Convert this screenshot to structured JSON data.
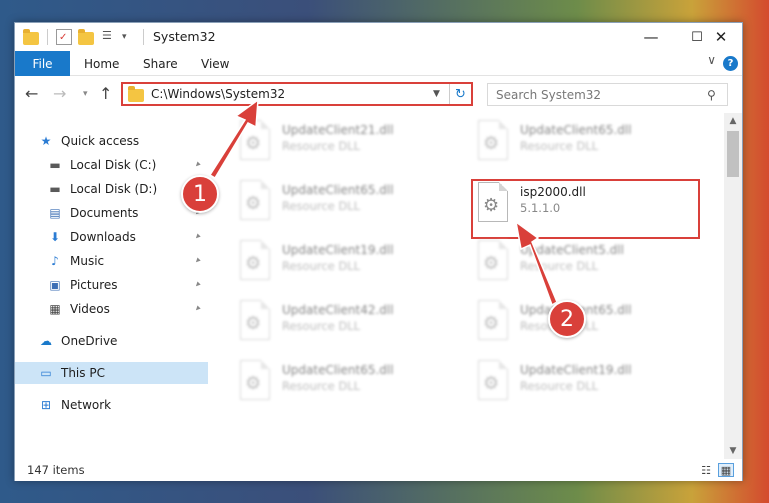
{
  "window": {
    "title": "System32",
    "controls": {
      "minimize": "—",
      "maximize": "☐",
      "close": "✕"
    }
  },
  "ribbon": {
    "tabs": [
      "File",
      "Home",
      "Share",
      "View"
    ],
    "help": "?"
  },
  "navbar": {
    "back": "←",
    "forward": "→",
    "up": "↑",
    "address": "C:\\Windows\\System32",
    "refresh": "↻",
    "search_placeholder": "Search System32"
  },
  "sidebar": {
    "items": [
      {
        "label": "Quick access",
        "icon": "star-icon",
        "glyph": "★",
        "color": "#2b7cd3",
        "pinned": false
      },
      {
        "label": "Local Disk (C:)",
        "icon": "drive-icon",
        "glyph": "▬",
        "color": "#5a5a5a",
        "pinned": true
      },
      {
        "label": "Local Disk (D:)",
        "icon": "drive-icon",
        "glyph": "▬",
        "color": "#5a5a5a",
        "pinned": true
      },
      {
        "label": "Documents",
        "icon": "documents-icon",
        "glyph": "▤",
        "color": "#3d6fb5",
        "pinned": true
      },
      {
        "label": "Downloads",
        "icon": "downloads-icon",
        "glyph": "⬇",
        "color": "#2b7cd3",
        "pinned": true
      },
      {
        "label": "Music",
        "icon": "music-icon",
        "glyph": "♪",
        "color": "#2b7cd3",
        "pinned": true
      },
      {
        "label": "Pictures",
        "icon": "pictures-icon",
        "glyph": "▣",
        "color": "#3d6fb5",
        "pinned": true
      },
      {
        "label": "Videos",
        "icon": "videos-icon",
        "glyph": "▦",
        "color": "#444444",
        "pinned": true
      },
      {
        "label": "OneDrive",
        "icon": "onedrive-icon",
        "glyph": "☁",
        "color": "#1979ca",
        "pinned": false
      },
      {
        "label": "This PC",
        "icon": "pc-icon",
        "glyph": "▭",
        "color": "#2b7cd3",
        "pinned": false
      },
      {
        "label": "Network",
        "icon": "network-icon",
        "glyph": "⊞",
        "color": "#2b7cd3",
        "pinned": false
      }
    ],
    "pin_glyph": "📌"
  },
  "files": {
    "left": [
      {
        "name": "UpdateClient21.dll",
        "sub": "Resource DLL"
      },
      {
        "name": "UpdateClient65.dll",
        "sub": "Resource DLL"
      },
      {
        "name": "UpdateClient19.dll",
        "sub": "Resource DLL"
      },
      {
        "name": "UpdateClient42.dll",
        "sub": "Resource DLL"
      },
      {
        "name": "UpdateClient65.dll",
        "sub": "Resource DLL"
      }
    ],
    "right": [
      {
        "name": "UpdateClient65.dll",
        "sub": "Resource DLL"
      },
      {
        "name": "isp2000.dll",
        "sub": "5.1.1.0"
      },
      {
        "name": "UpdateClient5.dll",
        "sub": "Resource DLL"
      },
      {
        "name": "UpdateClient65.dll",
        "sub": "Resource DLL"
      },
      {
        "name": "UpdateClient19.dll",
        "sub": "Resource DLL"
      }
    ]
  },
  "status": {
    "count": "147 items"
  },
  "callouts": [
    "1",
    "2"
  ],
  "colors": {
    "accent": "#1979ca",
    "highlight": "#d9403a",
    "selected": "#cce4f7"
  }
}
